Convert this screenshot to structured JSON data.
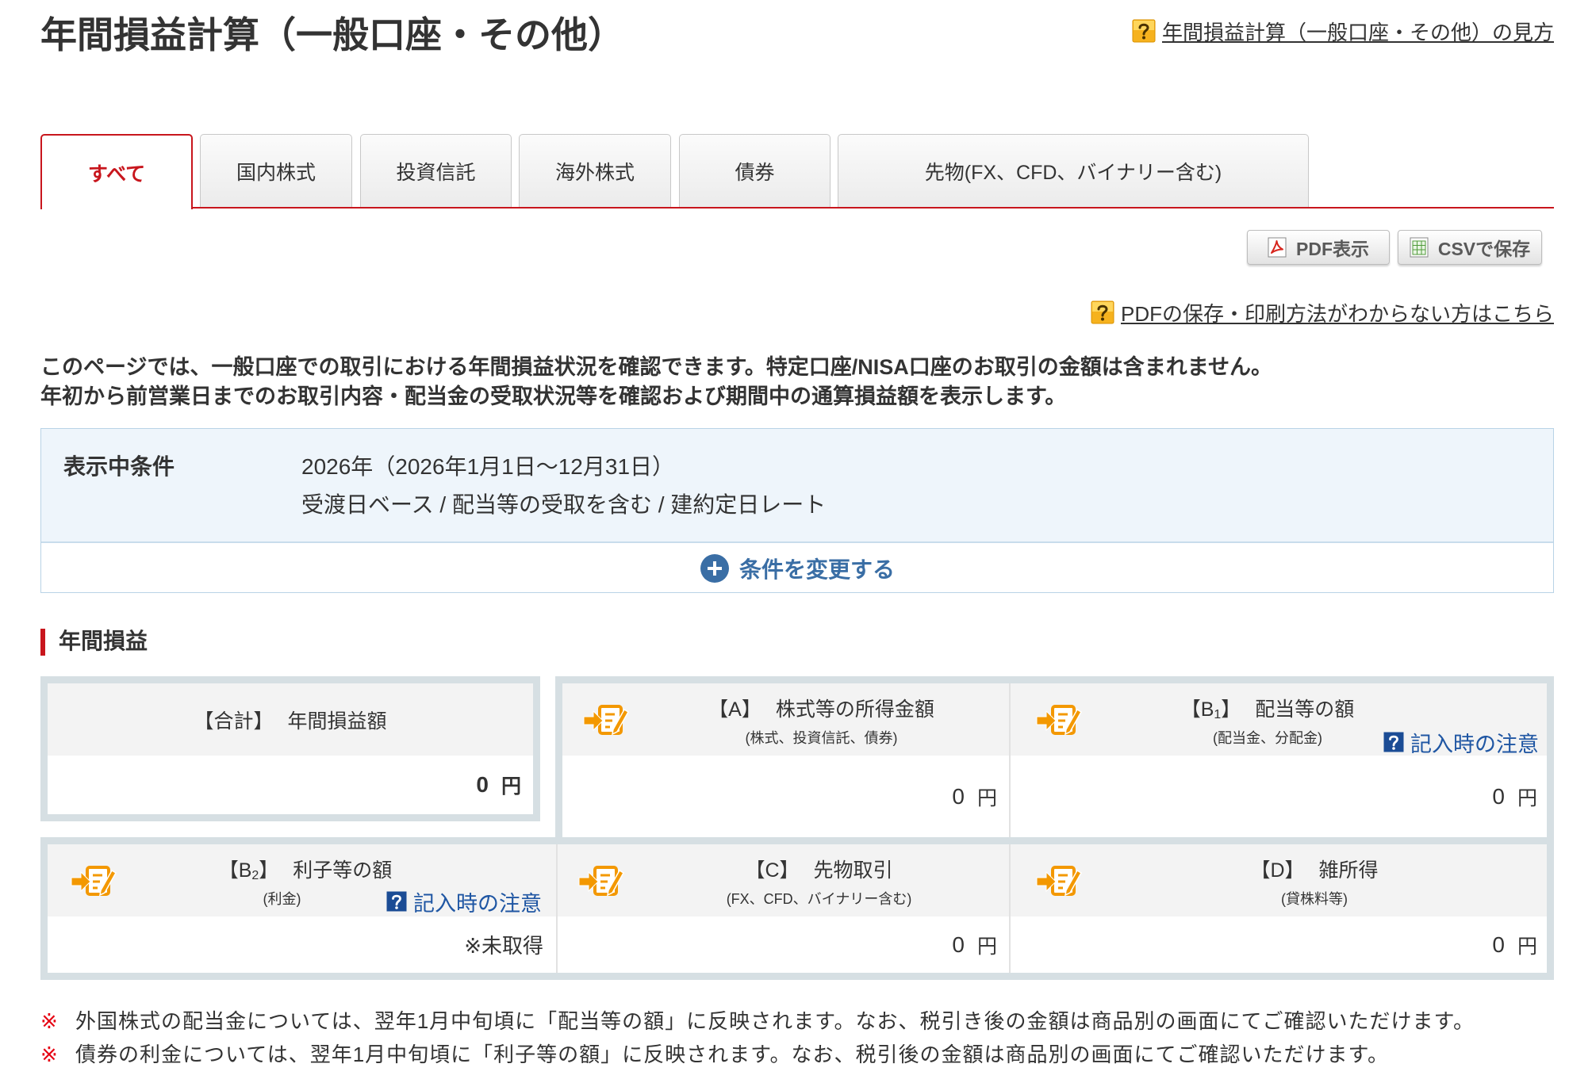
{
  "page": {
    "title": "年間損益計算（一般口座・その他）",
    "help_link": "年間損益計算（一般口座・その他）の見方"
  },
  "tabs": [
    {
      "label": "すべて",
      "active": true
    },
    {
      "label": "国内株式",
      "active": false
    },
    {
      "label": "投資信託",
      "active": false
    },
    {
      "label": "海外株式",
      "active": false
    },
    {
      "label": "債券",
      "active": false
    },
    {
      "label": "先物(FX、CFD、バイナリー含む)",
      "active": false
    }
  ],
  "toolbar": {
    "pdf_label": "PDF表示",
    "csv_label": "CSVで保存",
    "pdf_help_link": "PDFの保存・印刷方法がわからない方はこちら"
  },
  "description": [
    "このページでは、一般口座での取引における年間損益状況を確認できます。特定口座/NISA口座のお取引の金額は含まれません。",
    "年初から前営業日までのお取引内容・配当金の受取状況等を確認および期間中の通算損益額を表示します。"
  ],
  "conditions": {
    "label": "表示中条件",
    "period": "2026年（2026年1月1日～12月31日）",
    "settings": "受渡日ベース / 配当等の受取を含む / 建約定日レート",
    "change_button": "条件を変更する"
  },
  "annual": {
    "section_title": "年間損益",
    "total": {
      "code": "【合計】",
      "title": "年間損益額",
      "value": "0",
      "unit": "円"
    },
    "a": {
      "code": "【A】",
      "title": "株式等の所得金額",
      "note": "(株式、投資信託、債券)",
      "value": "0",
      "unit": "円"
    },
    "b1": {
      "code": "【B",
      "code_sub": "1",
      "code_end": "】",
      "title": "配当等の額",
      "note": "(配当金、分配金)",
      "caution_link": "記入時の注意",
      "value": "0",
      "unit": "円"
    },
    "b2": {
      "code": "【B",
      "code_sub": "2",
      "code_end": "】",
      "title": "利子等の額",
      "note": "(利金)",
      "caution_link": "記入時の注意",
      "value": "※未取得"
    },
    "c": {
      "code": "【C】",
      "title": "先物取引",
      "note": "(FX、CFD、バイナリー含む)",
      "value": "0",
      "unit": "円"
    },
    "d": {
      "code": "【D】",
      "title": "雑所得",
      "note": "(貸株料等)",
      "value": "0",
      "unit": "円"
    }
  },
  "notes": {
    "mark": "※",
    "items": [
      "外国株式の配当金については、翌年1月中旬頃に「配当等の額」に反映されます。なお、税引き後の金額は商品別の画面にてご確認いただけます。",
      "債券の利金については、翌年1月中旬頃に「利子等の額」に反映されます。なお、税引後の金額は商品別の画面にてご確認いただけます。"
    ]
  },
  "colors": {
    "accent": "#c8161d",
    "link": "#1f56a3",
    "edit_icon": "#f39800",
    "note_mark": "#e60012",
    "grid_border": "#d6dfe3",
    "condition_bg": "#eef5fb"
  },
  "icons": {
    "help": "question-icon",
    "pdf": "pdf-icon",
    "csv": "spreadsheet-icon",
    "change": "plus-circle-icon",
    "edit": "edit-note-icon",
    "caution": "question-icon"
  }
}
